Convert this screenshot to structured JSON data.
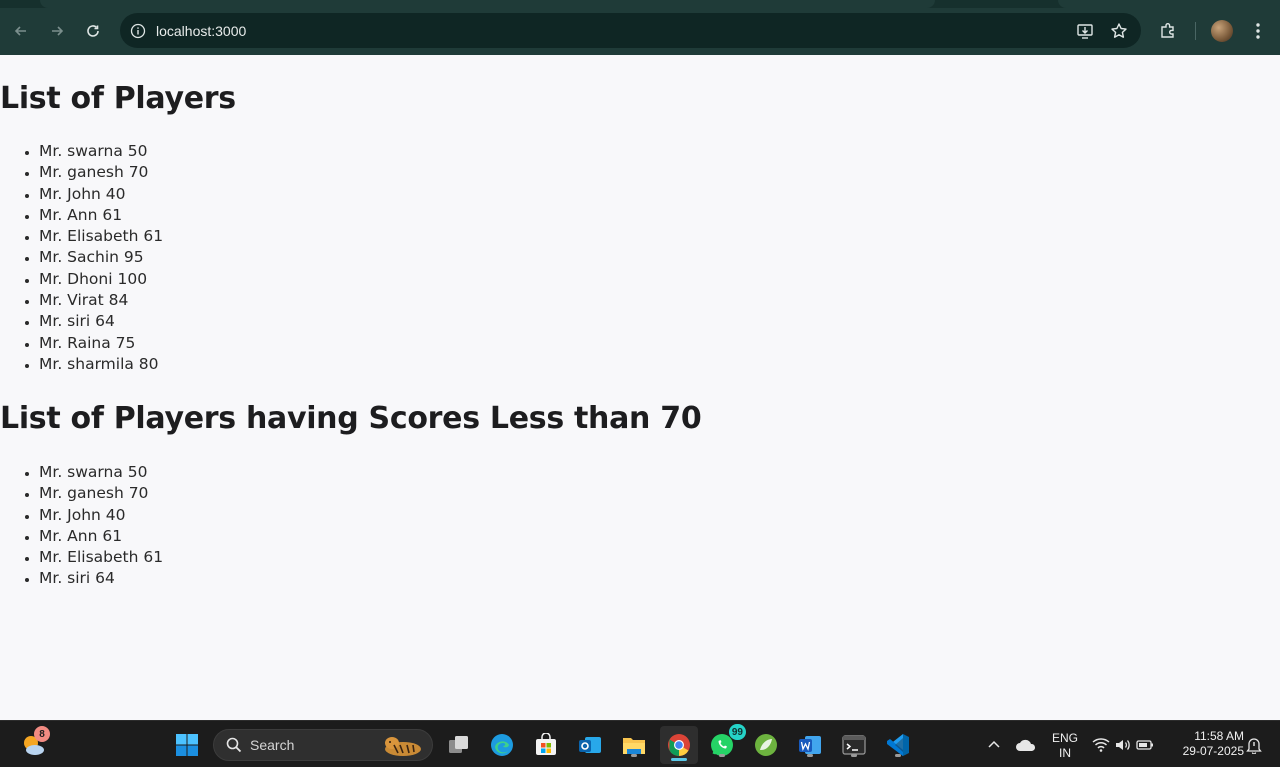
{
  "browser": {
    "url": "localhost:3000",
    "colors": {
      "toolbar": "#1f3b38",
      "omnibox": "#0f2624"
    },
    "icons": [
      "back-icon",
      "forward-icon",
      "reload-icon",
      "site-info-icon",
      "install-app-icon",
      "bookmark-star-icon",
      "extensions-icon",
      "profile-avatar",
      "more-menu-icon"
    ]
  },
  "page": {
    "heading_all": "List of Players",
    "players": [
      "Mr. swarna 50",
      "Mr. ganesh 70",
      "Mr. John 40",
      "Mr. Ann 61",
      "Mr. Elisabeth 61",
      "Mr. Sachin 95",
      "Mr. Dhoni 100",
      "Mr. Virat 84",
      "Mr. siri 64",
      "Mr. Raina 75",
      "Mr. sharmila 80"
    ],
    "heading_low": "List of Players having Scores Less than 70",
    "low_players": [
      "Mr. swarna 50",
      "Mr. ganesh 70",
      "Mr. John 40",
      "Mr. Ann 61",
      "Mr. Elisabeth 61",
      "Mr. siri 64"
    ]
  },
  "taskbar": {
    "weather_badge": "8",
    "search_label": "Search",
    "whatsapp_badge": "99",
    "language": "ENG",
    "region": "IN",
    "time": "11:58 AM",
    "date": "29-07-2025"
  }
}
